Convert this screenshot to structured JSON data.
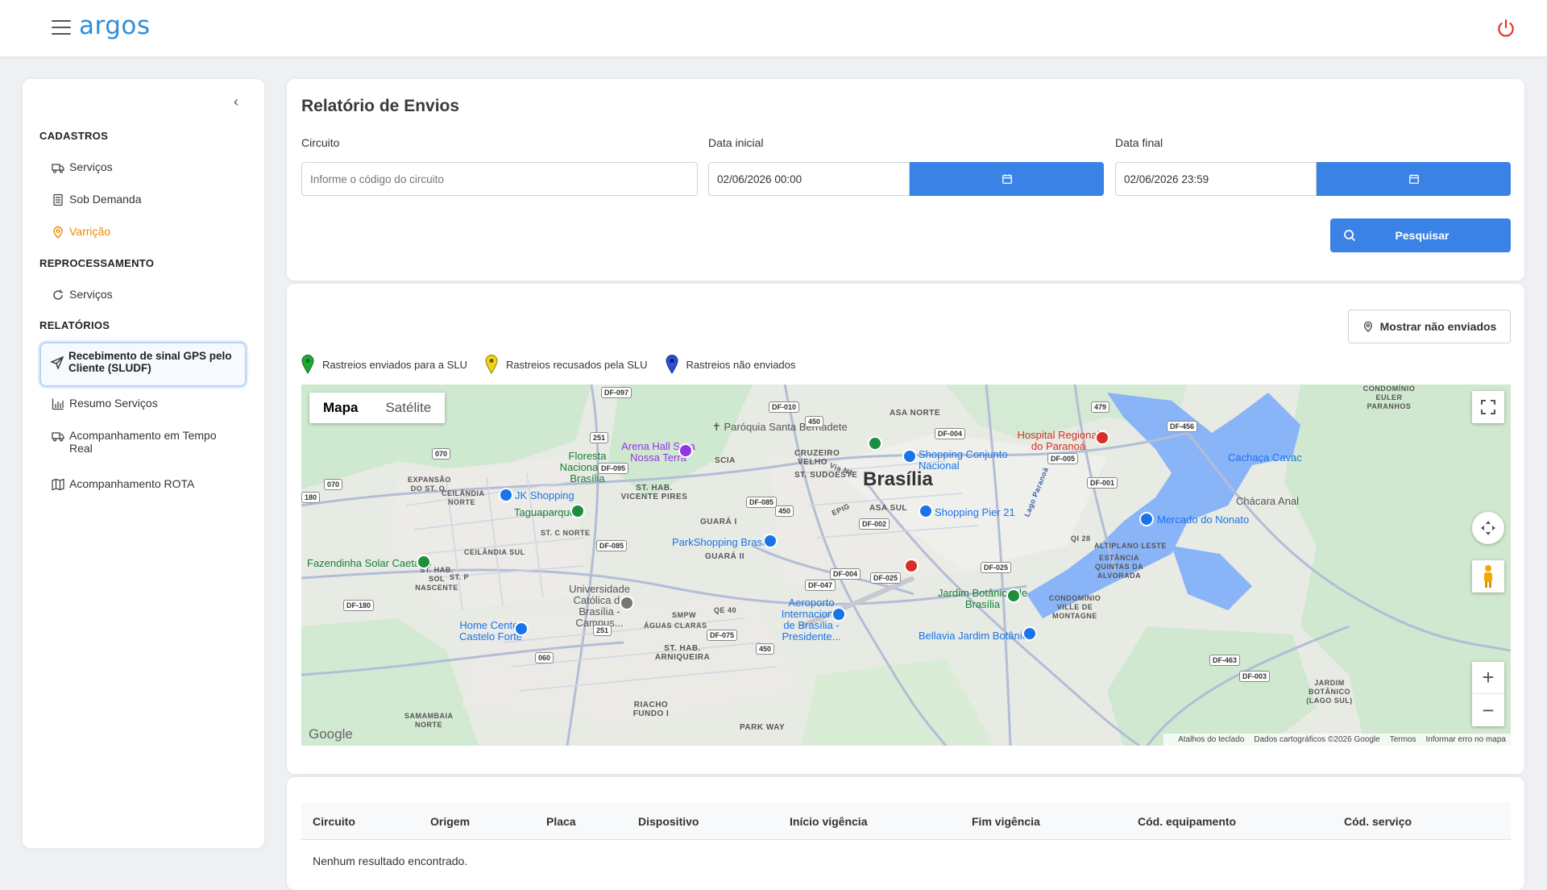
{
  "app": {
    "logo": "argos"
  },
  "sidebar": {
    "sections": {
      "cadastros": "CADASTROS",
      "reprocessamento": "REPROCESSAMENTO",
      "relatorios": "RELATÓRIOS"
    },
    "items": {
      "servicos": "Serviços",
      "sob_demanda": "Sob Demanda",
      "varricao": "Varrição",
      "reproc_servicos": "Serviços",
      "recebimento": "Recebimento de sinal GPS pelo Cliente (SLUDF)",
      "resumo": "Resumo Serviços",
      "acompanhamento_tempo_real": "Acompanhamento em Tempo Real",
      "acompanhamento_rota": "Acompanhamento ROTA"
    }
  },
  "form": {
    "title": "Relatório de Envios",
    "circuito_label": "Circuito",
    "circuito_placeholder": "Informe o código do circuito",
    "data_inicial_label": "Data inicial",
    "data_inicial_value": "02/06/2026 00:00",
    "data_final_label": "Data final",
    "data_final_value": "02/06/2026 23:59",
    "search_label": "Pesquisar"
  },
  "map_section": {
    "show_button": "Mostrar não enviados",
    "legend": [
      {
        "label": "Rastreios enviados para a SLU",
        "color": "#1fa83a"
      },
      {
        "label": "Rastreios recusados pela SLU",
        "color": "#f1d31b"
      },
      {
        "label": "Rastreios não enviados",
        "color": "#2b4fd8"
      }
    ],
    "map_type": {
      "map": "Mapa",
      "satellite": "Satélite"
    },
    "google": "Google",
    "attribution": {
      "shortcuts": "Atalhos do teclado",
      "data": "Dados cartográficos ©2026 Google",
      "terms": "Termos",
      "report": "Informar erro no mapa"
    },
    "labels": {
      "brasilia": "Brasília",
      "asa_norte": "ASA NORTE",
      "asa_sul": "ASA SUL",
      "sudoeste": "ST. SUDOESTE",
      "cruzeiro": "CRUZEIRO VELHO",
      "scia": "SCIA",
      "vicente": "ST. HAB. VICENTE PIRES",
      "guara1": "GUARÁ I",
      "guara2": "GUARÁ II",
      "expansao": "EXPANSÃO DO ST. O",
      "ceilandia_norte": "CEILÂNDIA NORTE",
      "ceilandia_sul": "CEILÂNDIA SUL",
      "sol_nascente": "ST. HAB. SOL NASCENTE",
      "st_c_norte": "ST. C NORTE",
      "st_p": "ST. P",
      "aguas_claras": "ÁGUAS CLARAS",
      "arniqueira": "ST. HAB. ARNIQUEIRA",
      "riacho": "RIACHO FUNDO I",
      "park_way": "PARK WAY",
      "samambaia": "SAMAMBAIA NORTE",
      "smpw": "SMPW",
      "qe40": "QE 40",
      "altiplano": "ALTIPLANO LESTE",
      "estancia": "ESTÂNCIA QUINTAS DA ALVORADA",
      "condominio_ville": "CONDOMÍNIO VILLE DE MONTAGNE",
      "condominio_euler": "CONDOMÍNIO EULER PARANHOS",
      "jardim_botanico_lago": "JARDIM BOTÂNICO (LAGO SUL)",
      "qi28": "QI 28",
      "lago_paranoa": "Lago Paranoá",
      "via_n1": "Via N1",
      "epig": "EPIG"
    },
    "pois": {
      "paroquia": "Paróquia Santa Bernadete",
      "arena": "Arena Hall Sara Nossa Terra",
      "floresta": "Floresta Nacional de Brasília",
      "jk": "JK Shopping",
      "taguaparque": "Taguaparque",
      "fazendinha": "Fazendinha Solar Caetano",
      "parkshopping": "ParkShopping Brasília",
      "ucb": "Universidade Católica de Brasília - Campus...",
      "home_center": "Home Center Castelo Forte",
      "aeroporto": "Aeroporto Internacional de Brasília - Presidente...",
      "shopping_cn": "Shopping Conjunto Nacional",
      "pier21": "Shopping Pier 21",
      "hospital": "Hospital Regional do Paranoá",
      "jardim_botanico": "Jardim Botânico de Brasília",
      "bellavia": "Bellavia Jardim Botânico",
      "mercado": "Mercado do Nonato",
      "cachaca": "Cachaça Cavac",
      "chacara": "Chácara Anal"
    },
    "shields": [
      "DF-097",
      "DF-010",
      "450",
      "251",
      "DF-095",
      "070",
      "070",
      "180",
      "DF-004",
      "DF-005",
      "DF-001",
      "DF-456",
      "479",
      "DF-085",
      "450",
      "DF-085",
      "DF-002",
      "DF-004",
      "DF-025",
      "DF-047",
      "DF-025",
      "DF-180",
      "251",
      "060",
      "DF-075",
      "450",
      "DF-463",
      "DF-003"
    ]
  },
  "table": {
    "headers": [
      "Circuito",
      "Origem",
      "Placa",
      "Dispositivo",
      "Início vigência",
      "Fim vigência",
      "Cód. equipamento",
      "Cód. serviço"
    ],
    "empty": "Nenhum resultado encontrado."
  }
}
